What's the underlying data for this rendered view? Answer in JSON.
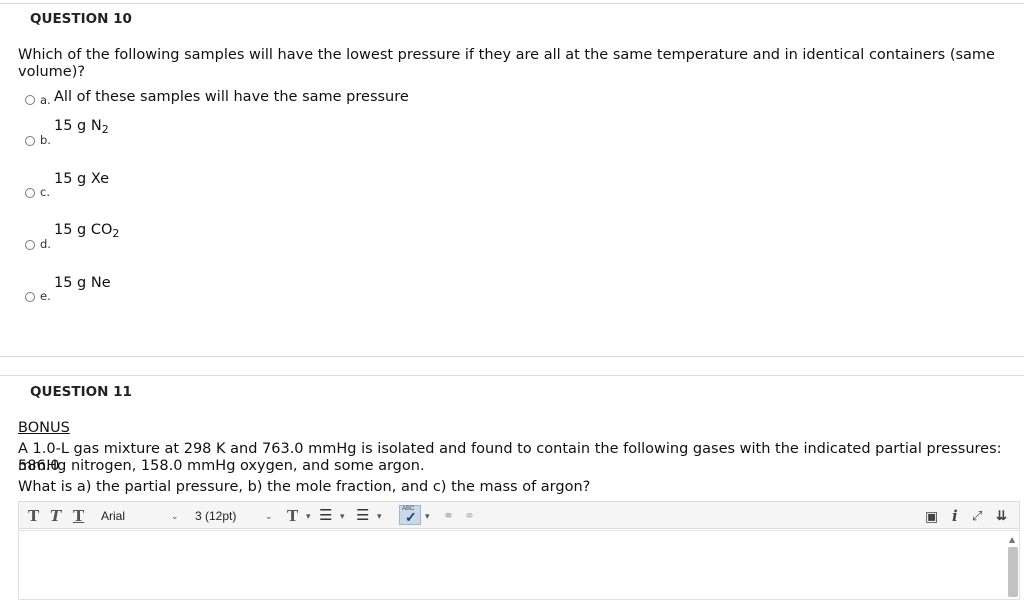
{
  "q10": {
    "title": "QUESTION 10",
    "text_line1": "Which of the following samples will have the lowest pressure if they are all at the same temperature and in identical containers (same",
    "text_line2": "volume)?",
    "options": [
      {
        "letter": "a.",
        "text": "All of these samples will have the same pressure"
      },
      {
        "letter": "b.",
        "text": "15 g N",
        "sub": "2"
      },
      {
        "letter": "c.",
        "text": "15 g Xe"
      },
      {
        "letter": "d.",
        "text": "15 g CO",
        "sub": "2"
      },
      {
        "letter": "e.",
        "text": "15 g Ne"
      }
    ]
  },
  "q11": {
    "title": "QUESTION 11",
    "bonus": "BONUS",
    "line1": "A 1.0-L gas mixture at 298 K and 763.0 mmHg is isolated and found to contain the following gases with the indicated partial pressures: 586.0",
    "line2": "mmHg nitrogen, 158.0 mmHg oxygen, and some argon.",
    "line3": "What is a) the partial pressure, b) the mole fraction, and c) the mass of argon?"
  },
  "toolbar": {
    "font_family": "Arial",
    "font_size": "3 (12pt)",
    "spell_label": "ABC"
  }
}
